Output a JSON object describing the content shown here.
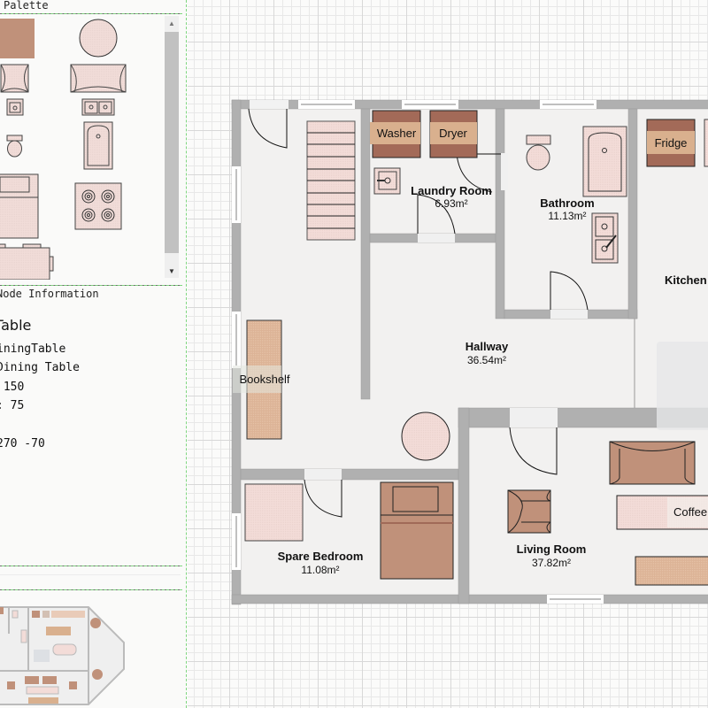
{
  "palette": {
    "title": "Palette",
    "items": [
      {
        "name": "table-rect",
        "icon": "square-table-icon"
      },
      {
        "name": "table-round",
        "icon": "round-table-icon"
      },
      {
        "name": "armchair",
        "icon": "armchair-icon"
      },
      {
        "name": "sofa",
        "icon": "sofa-icon"
      },
      {
        "name": "sink-single",
        "icon": "sink-icon"
      },
      {
        "name": "sink-double",
        "icon": "double-sink-icon"
      },
      {
        "name": "toilet",
        "icon": "toilet-icon"
      },
      {
        "name": "bathtub",
        "icon": "bathtub-icon"
      },
      {
        "name": "bed",
        "icon": "bed-icon"
      },
      {
        "name": "stove",
        "icon": "stove-icon"
      },
      {
        "name": "desk",
        "icon": "desk-icon"
      }
    ]
  },
  "info": {
    "title": "Node Information",
    "heading": "Table",
    "lines": [
      "iningTable",
      "Dining Table",
      " 150",
      ": 75",
      "",
      "270 -70"
    ]
  },
  "plan": {
    "rooms": [
      {
        "name": "Laundry Room",
        "area": "6.93m²"
      },
      {
        "name": "Bathroom",
        "area": "11.13m²"
      },
      {
        "name": "Kitchen",
        "area": ""
      },
      {
        "name": "Hallway",
        "area": "36.54m²"
      },
      {
        "name": "Spare Bedroom",
        "area": "11.08m²"
      },
      {
        "name": "Living Room",
        "area": "37.82m²"
      }
    ],
    "furniture": {
      "washer": "Washer",
      "dryer": "Dryer",
      "fridge": "Fridge",
      "bookshelf": "Bookshelf",
      "coffee": "Coffee"
    }
  },
  "colors": {
    "wall": "#b0b0b0",
    "floor": "#f2f1f0",
    "furniture_light": "#f3dcd8",
    "furniture_brown": "#c0917a",
    "appliance_dark": "#a36a58",
    "appliance_light": "#d9b08e",
    "bookshelf": "#dcb396"
  }
}
